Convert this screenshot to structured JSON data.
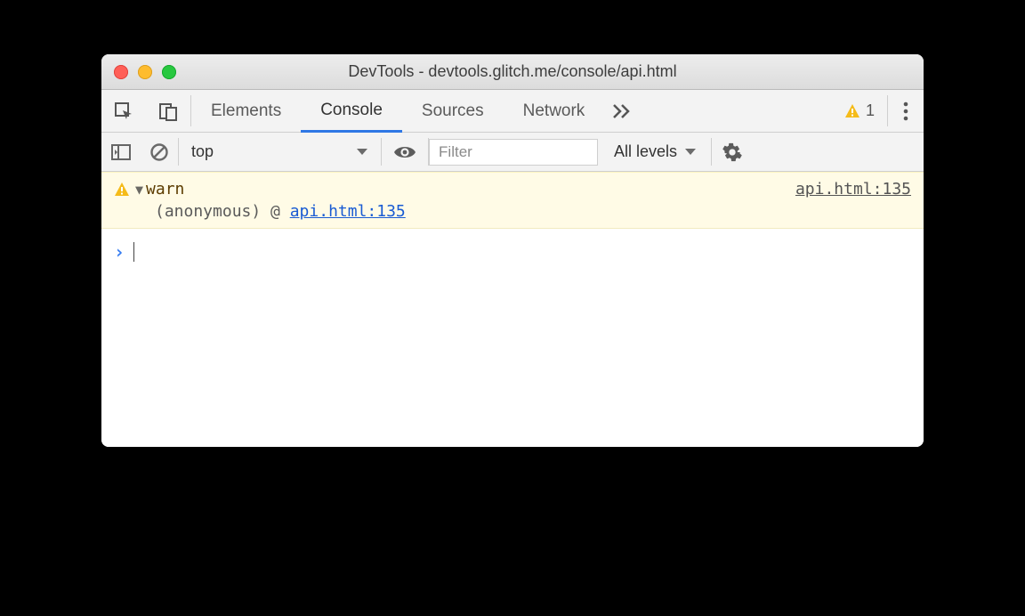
{
  "window": {
    "title": "DevTools - devtools.glitch.me/console/api.html"
  },
  "tabs": {
    "elements": "Elements",
    "console": "Console",
    "sources": "Sources",
    "network": "Network"
  },
  "warning_badge": {
    "count": "1"
  },
  "subbar": {
    "context": "top",
    "filter_placeholder": "Filter",
    "levels_label": "All levels"
  },
  "console": {
    "warn": {
      "label": "warn",
      "source": "api.html:135",
      "stack_prefix": "(anonymous) @ ",
      "stack_link": "api.html:135"
    }
  }
}
